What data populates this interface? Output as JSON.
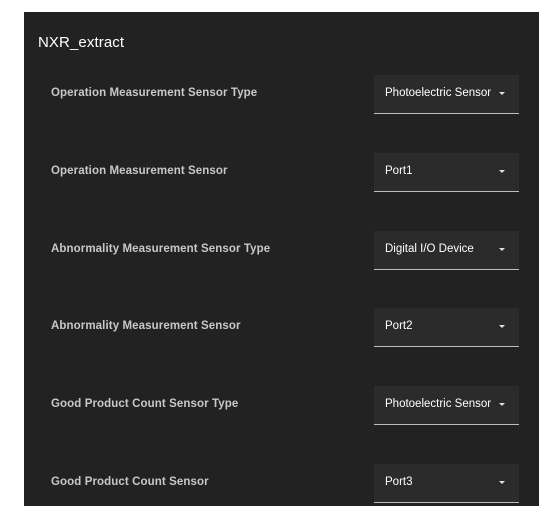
{
  "panel": {
    "title": "NXR_extract"
  },
  "settings": [
    {
      "label": "Operation Measurement Sensor Type",
      "value": "Photoelectric Sensor"
    },
    {
      "label": "Operation Measurement Sensor",
      "value": "Port1"
    },
    {
      "label": "Abnormality Measurement Sensor Type",
      "value": "Digital I/O Device"
    },
    {
      "label": "Abnormality Measurement Sensor",
      "value": "Port2"
    },
    {
      "label": "Good Product Count Sensor Type",
      "value": "Photoelectric Sensor"
    },
    {
      "label": "Good Product Count Sensor",
      "value": "Port3"
    }
  ],
  "icons": {
    "dropdown": "chevron-down-icon"
  },
  "colors": {
    "panel_background": "#222222",
    "select_background": "#2b2b2b",
    "text_primary": "#ffffff",
    "text_label": "#c8c8c8"
  }
}
